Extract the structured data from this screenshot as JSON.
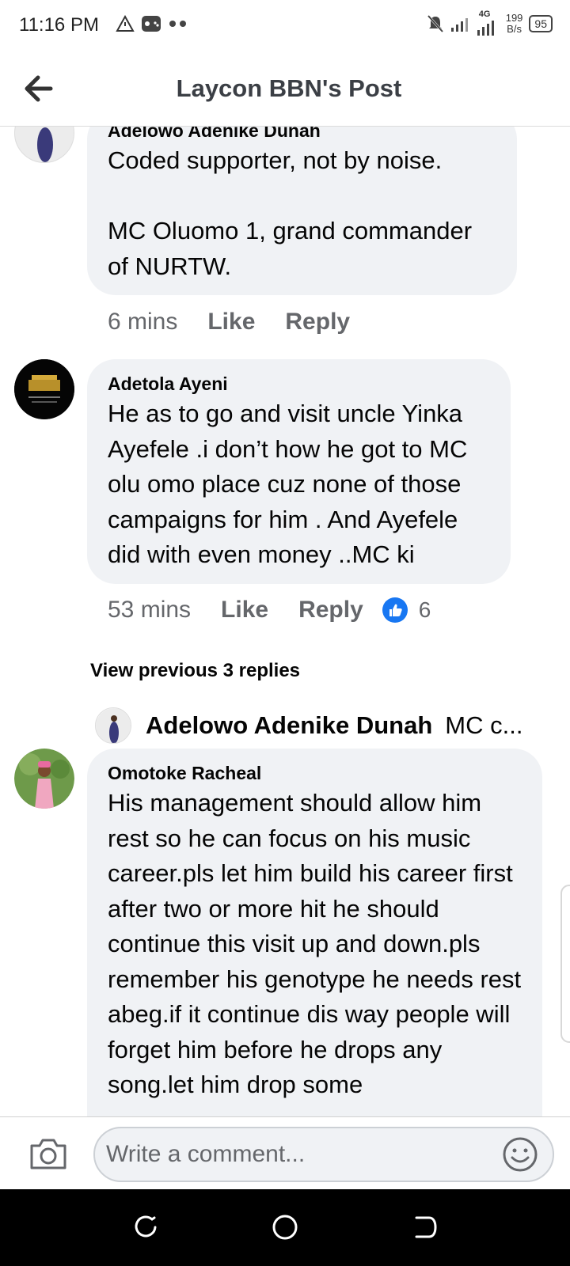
{
  "status_bar": {
    "time": "11:16 PM",
    "network_type": "4G",
    "net_speed_value": "199",
    "net_speed_unit": "B/s",
    "battery": "95"
  },
  "header": {
    "title": "Laycon BBN's Post"
  },
  "comments": [
    {
      "author": "Adelowo Adenike Dunah",
      "text": "Coded supporter, not by noise.\n\nMC Oluomo 1, grand commander of NURTW.",
      "time": "6 mins",
      "like_label": "Like",
      "reply_label": "Reply"
    },
    {
      "author": "Adetola Ayeni",
      "text": "He as to go and visit uncle Yinka Ayefele .i don’t how he got to MC olu omo place cuz none of those campaigns for him . And Ayefele did with even money ..MC ki",
      "time": "53 mins",
      "like_label": "Like",
      "reply_label": "Reply",
      "reaction_count": "6"
    },
    {
      "author": "Omotoke Racheal",
      "text": "His management should allow him rest so he can focus on his music career.pls let him build his career first after two or more hit he should continue  this visit up and down.pls remember his genotype he needs rest abeg.if it continue dis way people  will forget him before he drops any song.let him drop some"
    }
  ],
  "view_previous": "View previous 3 replies",
  "reply_preview": {
    "author": "Adelowo Adenike Dunah",
    "snippet": "MC c..."
  },
  "composer": {
    "placeholder": "Write a comment..."
  },
  "colors": {
    "bubble": "#f0f2f5",
    "meta_text": "#65676b",
    "like_blue": "#1877f2"
  }
}
